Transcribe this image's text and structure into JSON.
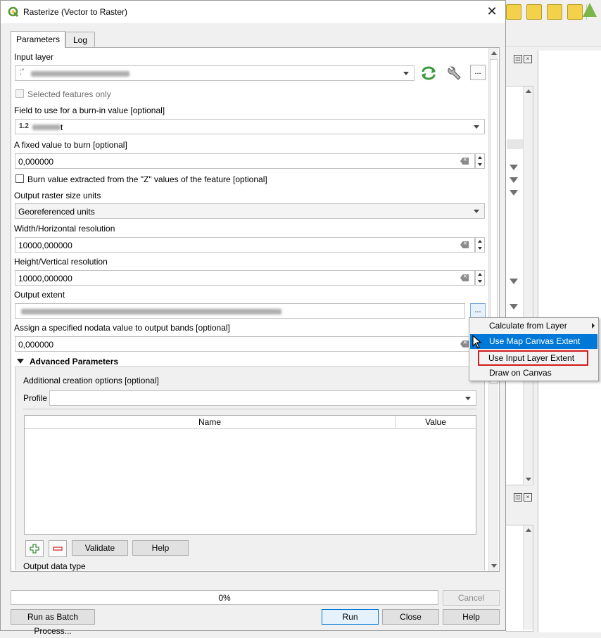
{
  "dialog": {
    "title": "Rasterize (Vector to Raster)",
    "tabs": [
      {
        "label": "Parameters",
        "active": true
      },
      {
        "label": "Log",
        "active": false
      }
    ]
  },
  "params": {
    "input_layer_label": "Input layer",
    "input_layer_value_prefix": "⁚˚",
    "selected_features_label": "Selected features only",
    "burn_field_label": "Field to use for a burn-in value [optional]",
    "burn_field_type_badge": "1.2",
    "burn_field_value_suffix": "t",
    "fixed_value_label": "A fixed value to burn [optional]",
    "fixed_value": "0,000000",
    "burn_z_label": "Burn value extracted from the \"Z\" values of the feature [optional]",
    "size_units_label": "Output raster size units",
    "size_units_value": "Georeferenced units",
    "width_label": "Width/Horizontal resolution",
    "width_value": "10000,000000",
    "height_label": "Height/Vertical resolution",
    "height_value": "10000,000000",
    "extent_label": "Output extent",
    "nodata_label": "Assign a specified nodata value to output bands [optional]",
    "nodata_value": "0,000000",
    "advanced_label": "Advanced Parameters",
    "creation_options_label": "Additional creation options [optional]",
    "profile_label": "Profile",
    "profile_value": "",
    "grid_columns": [
      "Name",
      "Value"
    ],
    "validate_label": "Validate",
    "help_small_label": "Help",
    "output_data_type_label": "Output data type",
    "more_button_label": "..."
  },
  "footer": {
    "progress_text": "0%",
    "progress_value": 0,
    "cancel_label": "Cancel",
    "batch_label": "Run as Batch Process...",
    "run_label": "Run",
    "close_label": "Close",
    "help_label": "Help"
  },
  "extent_menu": {
    "items": [
      {
        "label": "Calculate from Layer",
        "submenu": true
      },
      {
        "label": "Use Map Canvas Extent",
        "highlighted": true
      },
      {
        "label": "Use Input Layer Extent",
        "boxed": true
      },
      {
        "label": "Draw on Canvas"
      }
    ]
  },
  "colors": {
    "accent": "#0078d7",
    "highlight_box": "#d21b1b",
    "qgis_green": "#589632",
    "toolbar_yellow": "#f0c419"
  }
}
